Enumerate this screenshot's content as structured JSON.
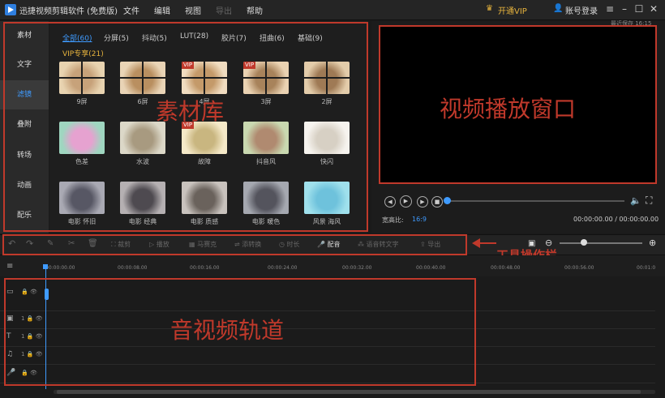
{
  "titlebar": {
    "app_title": "迅捷视频剪辑软件 (免费版)",
    "menus": [
      "文件",
      "编辑",
      "视图",
      "导出",
      "帮助"
    ],
    "vip_label": "开通VIP",
    "login_label": "账号登录",
    "window_buttons": [
      "menu-icon",
      "minimize-icon",
      "maximize-icon",
      "close-icon"
    ]
  },
  "categories": [
    "素材",
    "文字",
    "滤镜",
    "叠附",
    "转场",
    "动画",
    "配乐"
  ],
  "active_category": "滤镜",
  "filter_tabs": [
    "全部(60)",
    "分屏(5)",
    "抖动(5)",
    "LUT(28)",
    "胶片(7)",
    "扭曲(6)",
    "基础(9)"
  ],
  "vip_tab": "VIP专享(21)",
  "thumbnails": [
    {
      "caption": "9屏",
      "vip": false
    },
    {
      "caption": "6屏",
      "vip": false
    },
    {
      "caption": "4屏",
      "vip": true
    },
    {
      "caption": "3屏",
      "vip": true
    },
    {
      "caption": "2屏",
      "vip": false
    },
    {
      "caption": "色差",
      "vip": false
    },
    {
      "caption": "水波",
      "vip": false
    },
    {
      "caption": "故障",
      "vip": true
    },
    {
      "caption": "抖音风",
      "vip": false
    },
    {
      "caption": "快闪",
      "vip": false
    },
    {
      "caption": "电影 怀旧",
      "vip": false
    },
    {
      "caption": "电影 经典",
      "vip": false
    },
    {
      "caption": "电影 质感",
      "vip": false
    },
    {
      "caption": "电影 暖色",
      "vip": false
    },
    {
      "caption": "风景 海风",
      "vip": false
    }
  ],
  "vip_tag": "VIP",
  "annotations": {
    "materials": "素材库",
    "preview": "视频播放窗口",
    "toolbar": "工具操作栏",
    "tracks": "音视频轨道"
  },
  "preview": {
    "top_time": "最近保存 16:15",
    "ratio_label": "宽高比:",
    "ratio_value": "16:9",
    "time": "00:00:00.00 / 00:00:00.00",
    "progress": 0
  },
  "toolbar": {
    "items": [
      "裁剪",
      "播放",
      "马赛克",
      "添转换",
      "时长",
      "配音",
      "语音转文字",
      "导出"
    ],
    "enabled": [
      "配音",
      "导出"
    ]
  },
  "ruler": [
    "00:00:00.00",
    "00:00:08.00",
    "00:00:16.00",
    "00:00:24.00",
    "00:00:32.00",
    "00:00:40.00",
    "00:00:48.00",
    "00:00:56.00",
    "00:01:0"
  ],
  "tracks": [
    {
      "icon": "video-track-icon",
      "number": ""
    },
    {
      "icon": "pip-track-icon",
      "number": "1"
    },
    {
      "icon": "text-track-icon",
      "number": "1"
    },
    {
      "icon": "music-track-icon",
      "number": "1"
    },
    {
      "icon": "voice-track-icon",
      "number": ""
    }
  ],
  "colors": {
    "accent": "#3f9bff",
    "annotation": "#c0392b",
    "vip": "#e6b33d"
  }
}
